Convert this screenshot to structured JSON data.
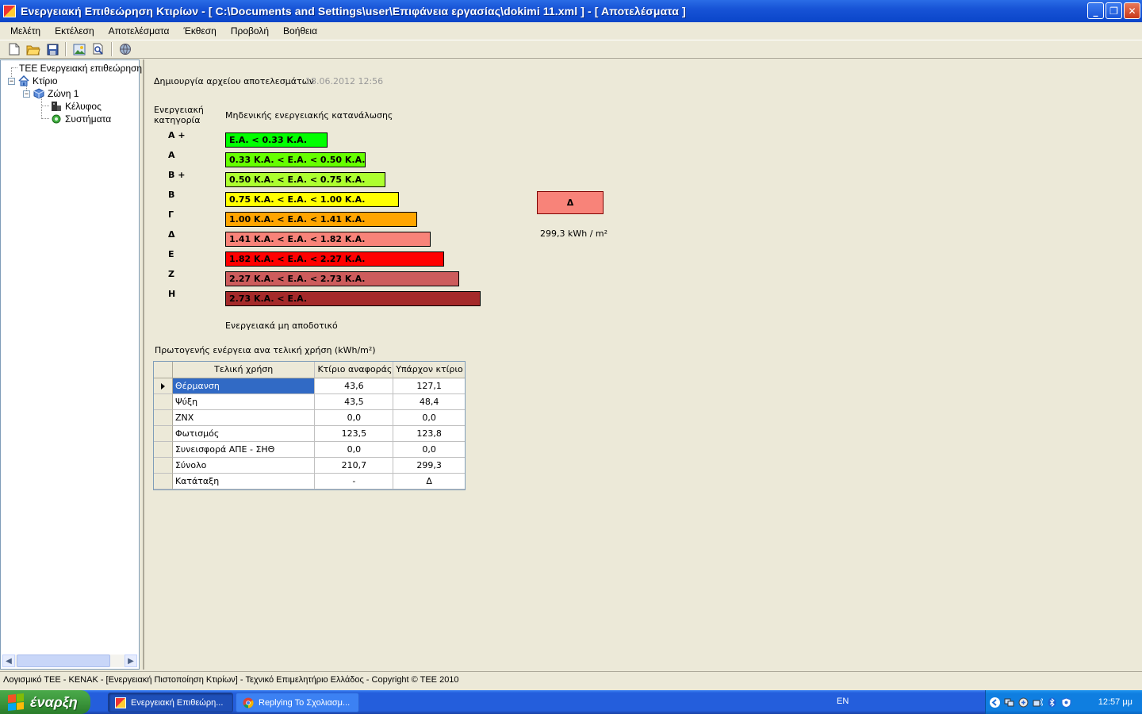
{
  "window": {
    "title": "Ενεργειακή Επιθεώρηση Κτιρίων - [ C:\\Documents and Settings\\user\\Επιφάνεια εργασίας\\dokimi 11.xml ] - [ Αποτελέσματα ]",
    "minimize": "_",
    "restore": "❐",
    "close": "✕"
  },
  "menu": [
    "Μελέτη",
    "Εκτέλεση",
    "Αποτελέσματα",
    "Έκθεση",
    "Προβολή",
    "Βοήθεια"
  ],
  "toolbar": {
    "icons": [
      "new-file-icon",
      "open-folder-icon",
      "save-icon",
      "image-icon",
      "print-preview-icon",
      "help-globe-icon"
    ]
  },
  "tree": {
    "root": "TEE  Ενεργειακή επιθεώρηση",
    "building": "Κτίριο",
    "zone": "Ζώνη 1",
    "envelope": "Κέλυφος",
    "systems": "Συστήματα",
    "collapse_symbol": "−"
  },
  "results": {
    "file_created_label": "Δημιουργία αρχείου αποτελεσμάτων",
    "file_created_date": "18.06.2012 12:56",
    "category_header": "Ενεργειακή κατηγορία",
    "zero_consumption_header": "Μηδενικής ενεργειακής κατανάλωσης",
    "inefficient_label": "Ενεργειακά μη αποδοτικό",
    "ratings": [
      {
        "label": "A +",
        "range": "E.A.  <  0.33 K.A.",
        "color": "#00ff00"
      },
      {
        "label": "A",
        "range": "0.33 K.A.  <   E.A.  <  0.50 K.A.",
        "color": "#66ff00"
      },
      {
        "label": "B +",
        "range": "0.50 K.A.  <   E.A.  <  0.75 K.A.",
        "color": "#adff2f"
      },
      {
        "label": "B",
        "range": "0.75 K.A.  <   E.A.  <  1.00 K.A.",
        "color": "#ffff00"
      },
      {
        "label": "Γ",
        "range": "1.00 K.A.  <   E.A.  <  1.41 K.A.",
        "color": "#ffa500"
      },
      {
        "label": "Δ",
        "range": "1.41 K.A.  <   E.A.  <  1.82 K.A.",
        "color": "#f88379"
      },
      {
        "label": "E",
        "range": "1.82 K.A.  <   E.A.  <  2.27 K.A.",
        "color": "#ff0000"
      },
      {
        "label": "Z",
        "range": "2.27 K.A.  <   E.A.  <  2.73 K.A.",
        "color": "#cd5c5c"
      },
      {
        "label": "H",
        "range": "2.73 K.A.  <   E.A.",
        "color": "#a52a2a"
      }
    ],
    "result_class": "Δ",
    "result_value": "299,3 kWh / m²",
    "primary_energy_title": "Πρωτογενής ενέργεια ανα τελική χρήση (kWh/m²)"
  },
  "table": {
    "headers": [
      "Τελική χρήση",
      "Κτίριο αναφοράς",
      "Υπάρχον κτίριο"
    ],
    "rows": [
      [
        "Θέρμανση",
        "43,6",
        "127,1"
      ],
      [
        "Ψύξη",
        "43,5",
        "48,4"
      ],
      [
        "ΖΝΧ",
        "0,0",
        "0,0"
      ],
      [
        "Φωτισμός",
        "123,5",
        "123,8"
      ],
      [
        "Συνεισφορά ΑΠΕ - ΣΗΘ",
        "0,0",
        "0,0"
      ],
      [
        "Σύνολο",
        "210,7",
        "299,3"
      ],
      [
        "Κατάταξη",
        "-",
        "Δ"
      ]
    ]
  },
  "status": "Λογισμικό ΤΕΕ - ΚΕΝΑΚ  -  [Ενεργειακή Πιστοποίηση Κτιρίων]  -  Τεχνικό Επιμελητήριο Ελλάδος  -  Copyright © TEE 2010",
  "taskbar": {
    "start": "έναρξη",
    "items": [
      "Ενεργειακή Επιθεώρη...",
      "Replying To Σχολιασμ..."
    ],
    "lang": "EN",
    "clock": "12:57 μμ"
  }
}
